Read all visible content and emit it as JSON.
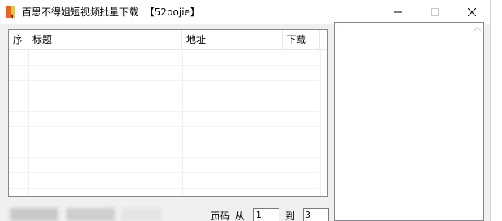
{
  "window": {
    "title": "百思不得姐短视频批量下载  【52pojie】",
    "icon": "app-bookmark-icon",
    "controls": {
      "minimize": "minimize-icon",
      "maximize": "maximize-icon",
      "close": "close-icon"
    }
  },
  "list": {
    "columns": [
      "序",
      "标题",
      "地址",
      "下载"
    ],
    "rows": []
  },
  "pager": {
    "page_label": "页码",
    "from_label": "从",
    "from_value": "1",
    "to_label": "到",
    "to_value": "3"
  },
  "colors": {
    "window_bg": "#f0f0f0",
    "titlebar_bg": "#ffffff",
    "border": "#828790",
    "icon_orange": "#e8642b"
  }
}
